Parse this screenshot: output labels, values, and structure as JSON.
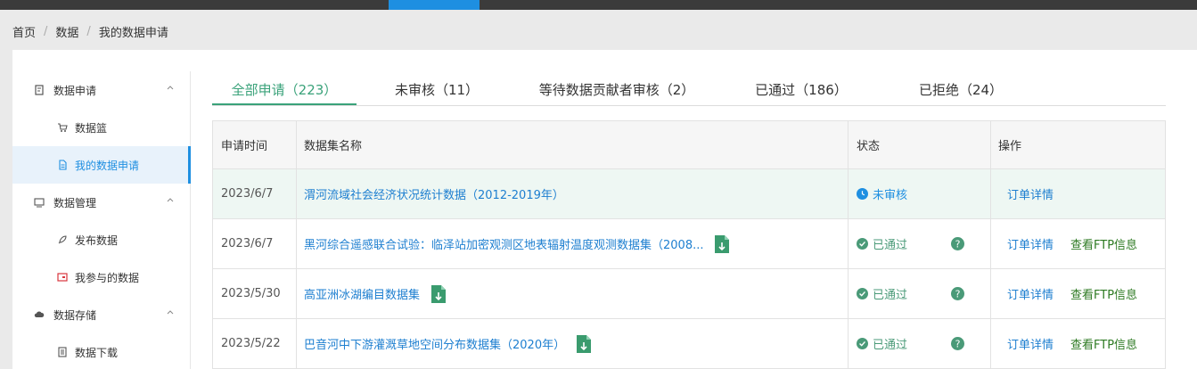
{
  "breadcrumb": [
    "首页",
    "数据",
    "我的数据申请"
  ],
  "sidebar": {
    "groups": [
      {
        "label": "数据申请",
        "icon": "document-icon",
        "items": [
          {
            "label": "数据篮",
            "icon": "cart-icon"
          },
          {
            "label": "我的数据申请",
            "icon": "file-icon",
            "active": true
          }
        ]
      },
      {
        "label": "数据管理",
        "icon": "monitor-icon",
        "items": [
          {
            "label": "发布数据",
            "icon": "rocket-icon"
          },
          {
            "label": "我参与的数据",
            "icon": "card-icon"
          }
        ]
      },
      {
        "label": "数据存储",
        "icon": "cloud-icon",
        "items": [
          {
            "label": "数据下载",
            "icon": "list-icon"
          }
        ]
      }
    ]
  },
  "tabs": [
    {
      "label": "全部申请（223）",
      "active": true
    },
    {
      "label": "未审核（11）"
    },
    {
      "label": "等待数据贡献者审核（2）"
    },
    {
      "label": "已通过（186）"
    },
    {
      "label": "已拒绝（24）"
    }
  ],
  "table": {
    "headers": [
      "申请时间",
      "数据集名称",
      "状态",
      "操作"
    ],
    "rows": [
      {
        "date": "2023/6/7",
        "name": "渭河流域社会经济状况统计数据（2012-2019年）",
        "status": "未审核",
        "status_type": "pending",
        "detail": "订单详情",
        "ftp": "",
        "has_file_icon": false
      },
      {
        "date": "2023/6/7",
        "name": "黑河综合遥感联合试验：临泽站加密观测区地表辐射温度观测数据集（2008...",
        "status": "已通过",
        "status_type": "passed",
        "detail": "订单详情",
        "ftp": "查看FTP信息",
        "has_file_icon": true
      },
      {
        "date": "2023/5/30",
        "name": "高亚洲冰湖编目数据集",
        "status": "已通过",
        "status_type": "passed",
        "detail": "订单详情",
        "ftp": "查看FTP信息",
        "has_file_icon": true
      },
      {
        "date": "2023/5/22",
        "name": "巴音河中下游灌溉草地空间分布数据集（2020年）",
        "status": "已通过",
        "status_type": "passed",
        "detail": "订单详情",
        "ftp": "查看FTP信息",
        "has_file_icon": true
      }
    ]
  },
  "colors": {
    "accent_green": "#3aa27a",
    "link_blue": "#1e7fd0",
    "topbar_active": "#1e8fe1"
  }
}
